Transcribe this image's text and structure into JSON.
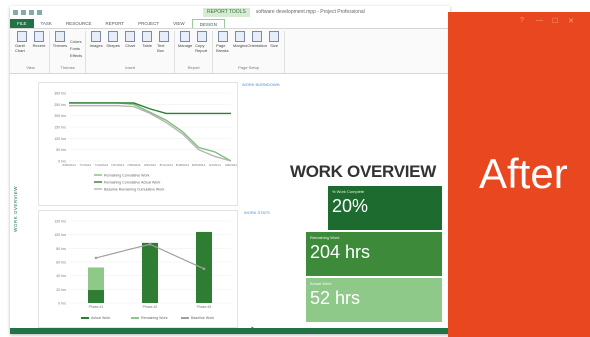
{
  "titlebar": {
    "context_tab": "REPORT TOOLS",
    "document_title": "software development.mpp - Project Professional"
  },
  "tabs": [
    "FILE",
    "TASK",
    "RESOURCE",
    "REPORT",
    "PROJECT",
    "VIEW",
    "DESIGN"
  ],
  "ribbon": {
    "groups": [
      {
        "label": "View",
        "buttons": [
          "Gantt Chart",
          "Recent"
        ]
      },
      {
        "label": "Themes",
        "buttons": [
          "Themes"
        ],
        "list": [
          "Colors",
          "Fonts",
          "Effects"
        ]
      },
      {
        "label": "Insert",
        "buttons": [
          "Images",
          "Shapes",
          "Chart",
          "Table",
          "Text Box"
        ]
      },
      {
        "label": "Report",
        "buttons": [
          "Manage",
          "Copy Report"
        ]
      },
      {
        "label": "Page Setup",
        "buttons": [
          "Page Breaks",
          "Margins",
          "Orientation",
          "Size"
        ]
      }
    ]
  },
  "side_label": "WORK OVERVIEW",
  "links": {
    "work_burndown": "WORK BURNDOWN",
    "work_stats": "WORK STATS"
  },
  "overview_title": "WORK OVERVIEW",
  "kpis": [
    {
      "label": "% Work Complete",
      "value": "20%",
      "color": "#1e6b2f"
    },
    {
      "label": "Remaining Work",
      "value": "204 hrs",
      "color": "#3d8b3a"
    },
    {
      "label": "Actual Work",
      "value": "52 hrs",
      "color": "#8fc98a"
    }
  ],
  "after_label": "After",
  "window_controls": [
    "?",
    "—",
    "☐",
    "✕"
  ],
  "chart_data": [
    {
      "type": "line",
      "title": "",
      "ylim": [
        0,
        300
      ],
      "y_ticks": [
        "0 hrs",
        "50 hrs",
        "100 hrs",
        "150 hrs",
        "200 hrs",
        "250 hrs",
        "300 hrs"
      ],
      "x": [
        "6/30/2014",
        "7/7/2014",
        "7/14/2014",
        "7/21/2014",
        "7/28/2014",
        "8/4/2014",
        "8/11/2014",
        "8/18/2014",
        "8/25/2014",
        "9/1/2014",
        "9/8/2014"
      ],
      "series": [
        {
          "name": "Remaining Cumulative Work",
          "color": "#7fbf7b",
          "values": [
            256,
            256,
            256,
            256,
            250,
            215,
            180,
            130,
            60,
            40,
            0
          ]
        },
        {
          "name": "Remaining Cumulative Actual Work",
          "color": "#2e7d32",
          "values": [
            256,
            256,
            256,
            256,
            256,
            230,
            210,
            210,
            210,
            210,
            210
          ]
        },
        {
          "name": "Baseline Remaining Cumulative Work",
          "color": "#b5b5b5",
          "values": [
            244,
            244,
            244,
            244,
            240,
            210,
            170,
            120,
            50,
            20,
            0
          ]
        }
      ]
    },
    {
      "type": "bar",
      "title": "",
      "ylim": [
        0,
        120
      ],
      "y_ticks": [
        "0 hrs",
        "20 hrs",
        "40 hrs",
        "60 hrs",
        "80 hrs",
        "100 hrs",
        "120 hrs"
      ],
      "categories": [
        "Phase #1",
        "Phase #2",
        "Phase #3"
      ],
      "series": [
        {
          "name": "Actual Work",
          "color": "#2e7d32",
          "values": [
            19,
            88,
            104
          ]
        },
        {
          "name": "Remaining Work",
          "color": "#8fc98a",
          "values": [
            33,
            0,
            0
          ]
        },
        {
          "name": "Baseline Work",
          "color": "#a0a0a0",
          "values": [
            66,
            86,
            50
          ]
        }
      ]
    }
  ]
}
